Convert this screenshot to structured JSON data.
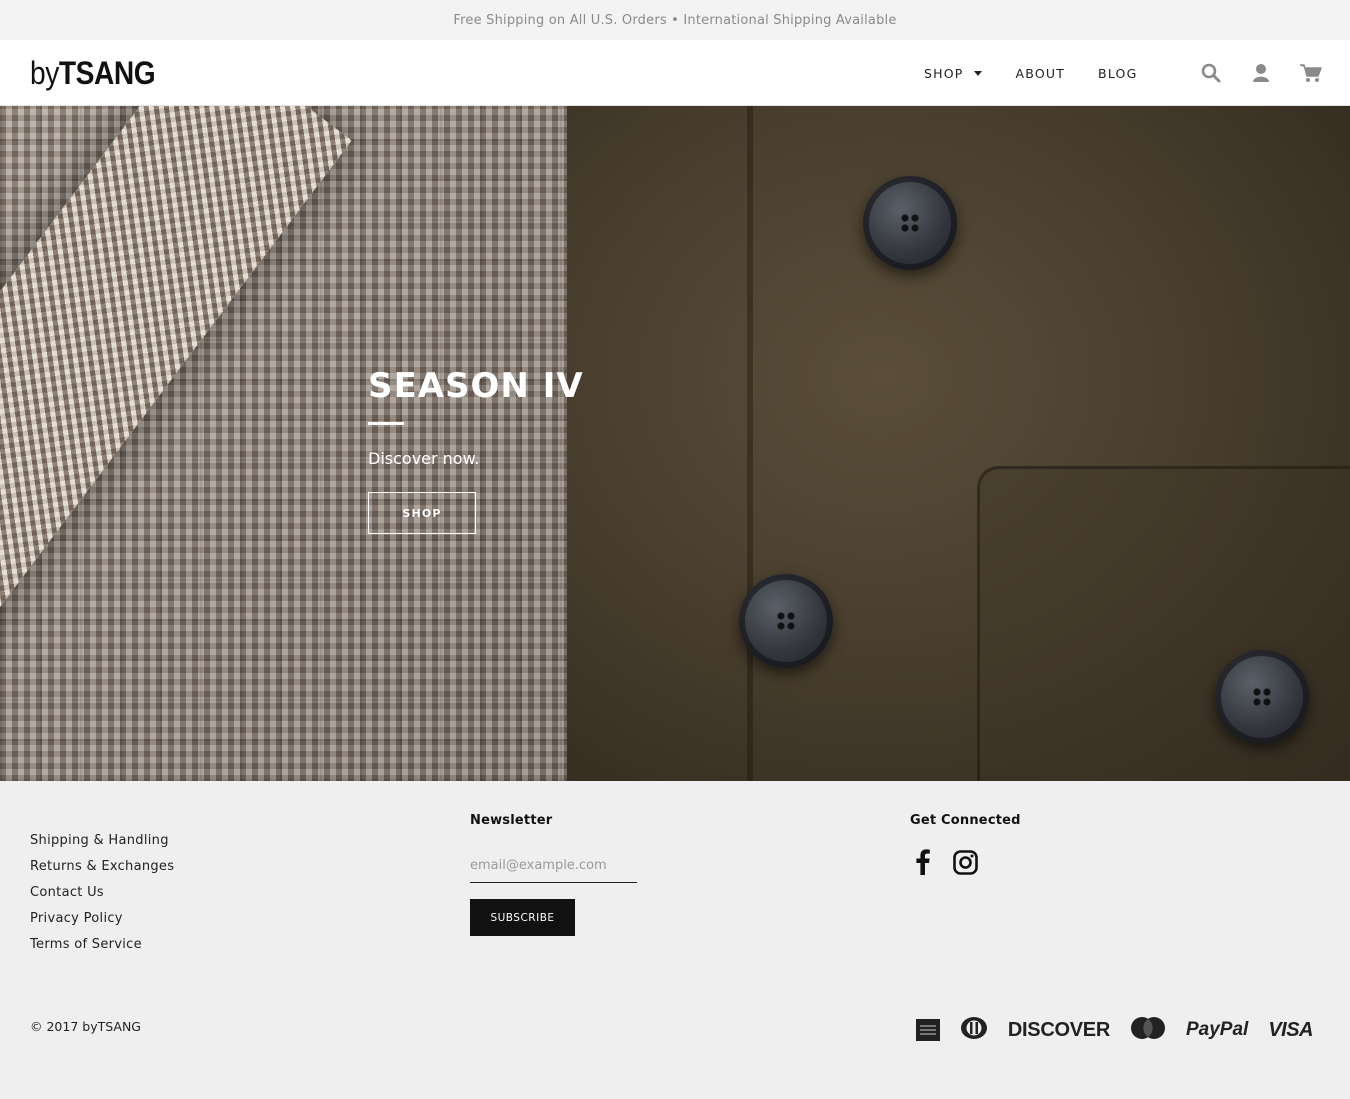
{
  "announcement": "Free Shipping on All U.S. Orders • International Shipping Available",
  "brand": {
    "prefix": "by",
    "name": "TSANG"
  },
  "nav": {
    "items": [
      {
        "label": "SHOP",
        "has_dropdown": true
      },
      {
        "label": "ABOUT"
      },
      {
        "label": "BLOG"
      }
    ]
  },
  "header_icons": [
    "search-icon",
    "account-icon",
    "cart-icon"
  ],
  "hero": {
    "title": "SEASON IV",
    "subtitle": "Discover now.",
    "button_label": "SHOP"
  },
  "footer": {
    "links": [
      "Shipping & Handling",
      "Returns & Exchanges",
      "Contact Us",
      "Privacy Policy",
      "Terms of Service"
    ],
    "newsletter": {
      "title": "Newsletter",
      "placeholder": "email@example.com",
      "button_label": "SUBSCRIBE"
    },
    "social": {
      "title": "Get Connected",
      "icons": [
        "facebook-icon",
        "instagram-icon"
      ]
    },
    "copyright": "© 2017 byTSANG",
    "payments": {
      "discover": "DISCOVER",
      "paypal": "PayPal",
      "visa": "VISA"
    }
  },
  "colors": {
    "accent": "#111111",
    "background": "#efefef"
  }
}
